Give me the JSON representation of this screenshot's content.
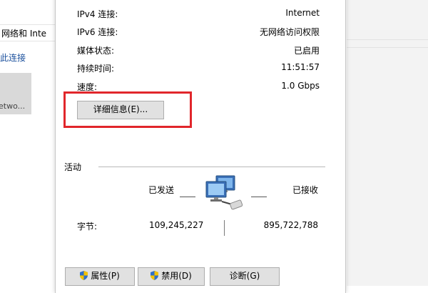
{
  "background": {
    "breadcrumb_text": "网络和 Inte",
    "command_text": "此连接",
    "tile_text": "etwo..."
  },
  "dialog": {
    "rows": [
      {
        "label": "IPv4 连接:",
        "value": "Internet"
      },
      {
        "label": "IPv6 连接:",
        "value": "无网络访问权限"
      },
      {
        "label": "媒体状态:",
        "value": "已启用"
      },
      {
        "label": "持续时间:",
        "value": "11:51:57"
      },
      {
        "label": "速度:",
        "value": "1.0 Gbps"
      }
    ],
    "details_button": "详细信息(E)...",
    "activity_title": "活动",
    "sent_label": "已发送",
    "received_label": "已接收",
    "bytes_label": "字节:",
    "bytes_sent": "109,245,227",
    "bytes_received": "895,722,788",
    "buttons": {
      "properties": "属性(P)",
      "disable": "禁用(D)",
      "diagnose": "诊断(G)"
    }
  },
  "colors": {
    "highlight": "#e1262b",
    "link": "#1a4f9c"
  },
  "icons": {
    "network": "network-computers-icon",
    "shield": "uac-shield-icon"
  }
}
